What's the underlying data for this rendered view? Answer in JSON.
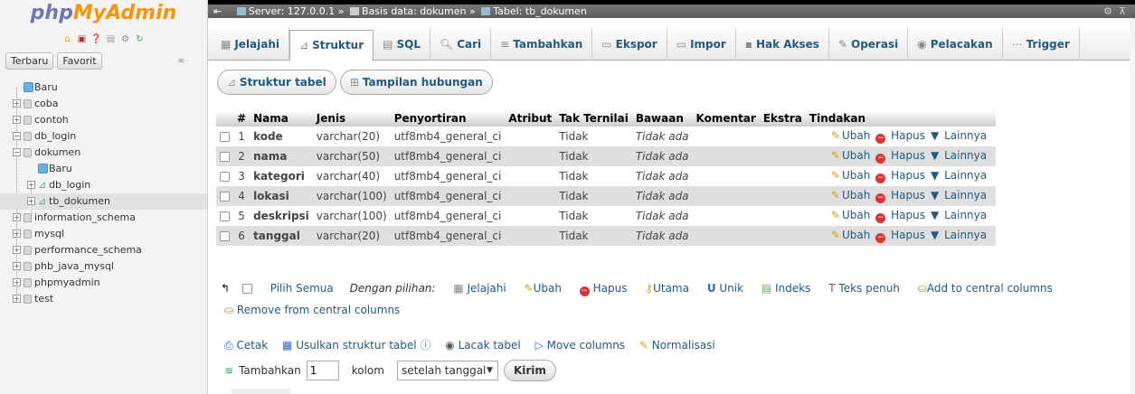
{
  "sidebar": {
    "logo_part1": "php",
    "logo_part2": "MyAdmin",
    "recent_tab": "Terbaru",
    "favorite_tab": "Favorit",
    "tree": [
      {
        "label": "Baru",
        "level": 0,
        "type": "new"
      },
      {
        "label": "coba",
        "level": 0,
        "type": "db"
      },
      {
        "label": "contoh",
        "level": 0,
        "type": "db"
      },
      {
        "label": "db_login",
        "level": 0,
        "type": "db"
      },
      {
        "label": "dokumen",
        "level": 0,
        "type": "db"
      },
      {
        "label": "Baru",
        "level": 1,
        "type": "new"
      },
      {
        "label": "db_login",
        "level": 1,
        "type": "table"
      },
      {
        "label": "tb_dokumen",
        "level": 1,
        "type": "table",
        "selected": true
      },
      {
        "label": "information_schema",
        "level": 0,
        "type": "db"
      },
      {
        "label": "mysql",
        "level": 0,
        "type": "db"
      },
      {
        "label": "performance_schema",
        "level": 0,
        "type": "db"
      },
      {
        "label": "phb_java_mysql",
        "level": 0,
        "type": "db"
      },
      {
        "label": "phpmyadmin",
        "level": 0,
        "type": "db"
      },
      {
        "label": "test",
        "level": 0,
        "type": "db"
      }
    ]
  },
  "breadcrumb": {
    "server": "Server: 127.0.0.1",
    "database": "Basis data: dokumen",
    "table": "Tabel: tb_dokumen"
  },
  "tabs": [
    "Jelajahi",
    "Struktur",
    "SQL",
    "Cari",
    "Tambahkan",
    "Ekspor",
    "Impor",
    "Hak Akses",
    "Operasi",
    "Pelacakan",
    "Trigger"
  ],
  "subtabs": {
    "structure": "Struktur tabel",
    "relation": "Tampilan hubungan"
  },
  "table": {
    "headers": [
      "#",
      "Nama",
      "Jenis",
      "Penyortiran",
      "Atribut",
      "Tak Ternilai",
      "Bawaan",
      "Komentar",
      "Ekstra",
      "Tindakan"
    ],
    "rows": [
      {
        "no": "1",
        "name": "kode",
        "type": "varchar(20)",
        "collation": "utf8mb4_general_ci",
        "null": "Tidak",
        "default": "Tidak ada"
      },
      {
        "no": "2",
        "name": "nama",
        "type": "varchar(50)",
        "collation": "utf8mb4_general_ci",
        "null": "Tidak",
        "default": "Tidak ada"
      },
      {
        "no": "3",
        "name": "kategori",
        "type": "varchar(40)",
        "collation": "utf8mb4_general_ci",
        "null": "Tidak",
        "default": "Tidak ada"
      },
      {
        "no": "4",
        "name": "lokasi",
        "type": "varchar(100)",
        "collation": "utf8mb4_general_ci",
        "null": "Tidak",
        "default": "Tidak ada"
      },
      {
        "no": "5",
        "name": "deskripsi",
        "type": "varchar(100)",
        "collation": "utf8mb4_general_ci",
        "null": "Tidak",
        "default": "Tidak ada"
      },
      {
        "no": "6",
        "name": "tanggal",
        "type": "varchar(20)",
        "collation": "utf8mb4_general_ci",
        "null": "Tidak",
        "default": "Tidak ada"
      }
    ],
    "action_edit": "Ubah",
    "action_delete": "Hapus",
    "action_more": "Lainnya"
  },
  "with_selected": {
    "check_all": "Pilih Semua",
    "label": "Dengan pilihan:",
    "browse": "Jelajahi",
    "edit": "Ubah",
    "delete": "Hapus",
    "primary": "Utama",
    "unique": "Unik",
    "index": "Indeks",
    "fulltext": "Teks penuh",
    "add_central": "Add to central columns",
    "remove_central": "Remove from central columns"
  },
  "bottom": {
    "print": "Cetak",
    "propose": "Usulkan struktur tabel",
    "track": "Lacak tabel",
    "move": "Move columns",
    "normalize": "Normalisasi"
  },
  "add_columns": {
    "label": "Tambahkan",
    "count": "1",
    "unit": "kolom",
    "position": "setelah tanggal",
    "submit": "Kirim"
  }
}
